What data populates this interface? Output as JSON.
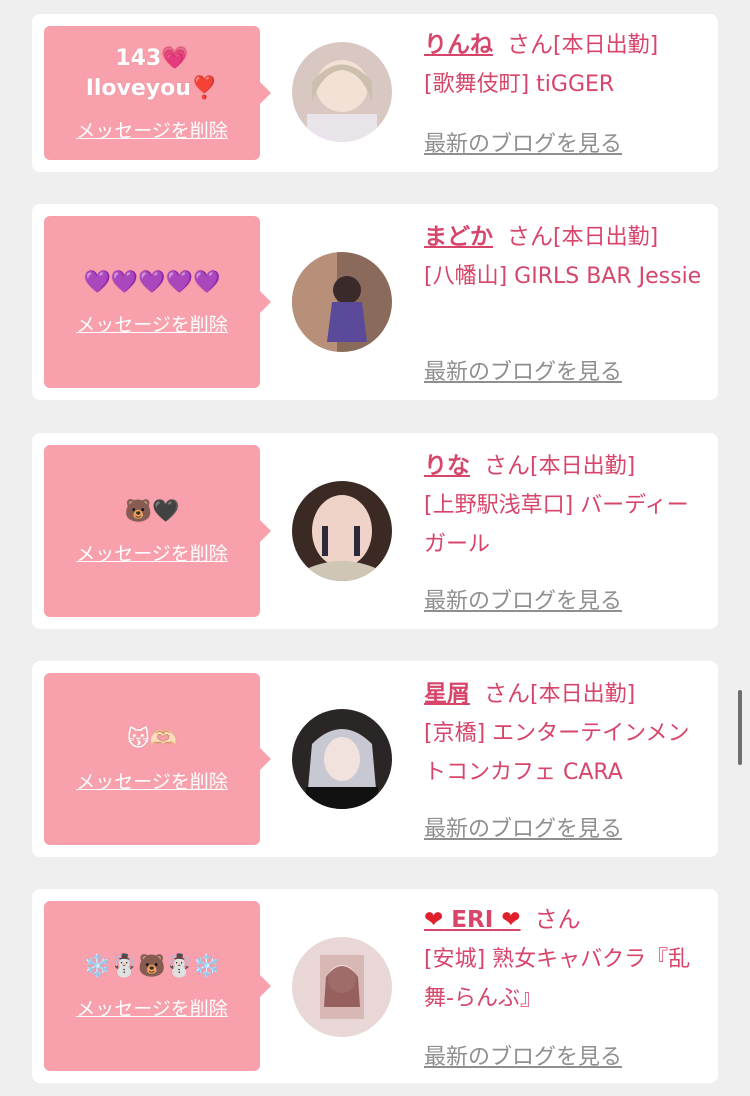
{
  "colors": {
    "bubble": "#f8a1ac",
    "accent": "#d7456a",
    "blog_link": "#8f8f8f",
    "background": "#efefef"
  },
  "items": [
    {
      "message": "143💗\nIloveyou❣️",
      "delete_label": "メッセージを削除",
      "name": "りんね",
      "honorific": "さん",
      "status": "[本日出勤]",
      "shop": "[歌舞伎町] tiGGER",
      "blog_label": "最新のブログを見る"
    },
    {
      "message": "💜💜💜💜💜",
      "delete_label": "メッセージを削除",
      "name": "まどか",
      "honorific": "さん",
      "status": "[本日出勤]",
      "shop": "[八幡山] GIRLS BAR Jessie",
      "blog_label": "最新のブログを見る"
    },
    {
      "message": "🐻🖤",
      "delete_label": "メッセージを削除",
      "name": "りな",
      "honorific": "さん",
      "status": "[本日出勤]",
      "shop": "[上野駅浅草口] バーディーガール",
      "blog_label": "最新のブログを見る"
    },
    {
      "message": "😽🫶🏻",
      "delete_label": "メッセージを削除",
      "name": "星屑",
      "honorific": "さん",
      "status": "[本日出勤]",
      "shop": "[京橋] エンターテインメントコンカフェ CARA",
      "blog_label": "最新のブログを見る"
    },
    {
      "message": "❄️☃️🐻☃️❄️",
      "delete_label": "メッセージを削除",
      "name_prefix_icon": "heart-icon",
      "name": "ERI",
      "name_suffix_icon": "heart-icon",
      "heart_glyph": "❤",
      "honorific": "さん",
      "status": "",
      "shop": "[安城] 熟女キャバクラ『乱舞-らんぶ』",
      "blog_label": "最新のブログを見る"
    }
  ]
}
